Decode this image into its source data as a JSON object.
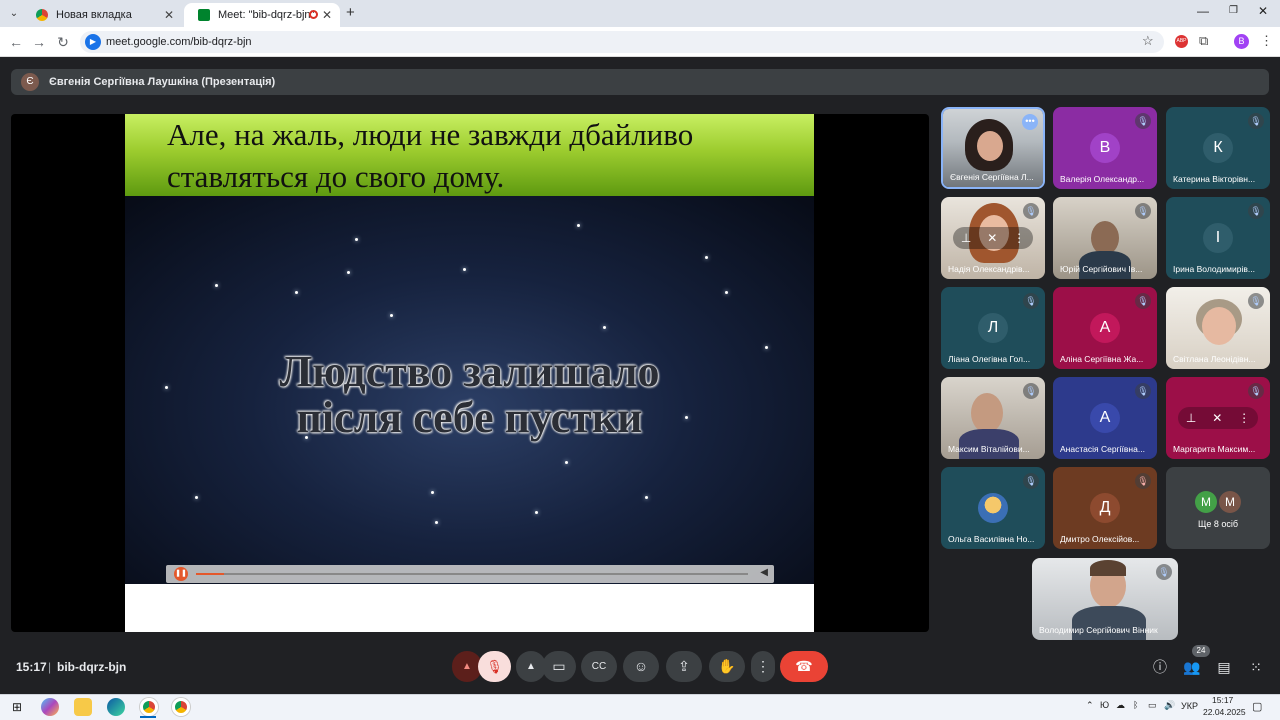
{
  "browser": {
    "tabs": [
      {
        "title": "Новая вкладка",
        "active": false
      },
      {
        "title": "Meet: \"bib-dqrz-bjn\"",
        "active": true
      }
    ],
    "new_tab": "+",
    "url": "meet.google.com/bib-dqrz-bjn",
    "profile_initial": "B"
  },
  "meet": {
    "presenter_bar": {
      "avatar": "Є",
      "title": "Євгенія Сергіївна Лаушкіна (Презентація)"
    },
    "slide": {
      "top_line1": "Але, на жаль, люди не завжди дбайливо",
      "top_line2": "ставляться до свого дому.",
      "main_line1": "Людство залишало",
      "main_line2": "після себе пустки"
    },
    "participants": [
      {
        "name": "Євгенія Сергіївна Л...",
        "type": "video"
      },
      {
        "name": "Валерія Олександр...",
        "initial": "В",
        "color": "#a142c7",
        "bg": "#8b2ca3"
      },
      {
        "name": "Катерина Вікторівн...",
        "initial": "К",
        "color": "#2f5d6b",
        "bg": "#1f4d5a"
      },
      {
        "name": "Надія Олександрів...",
        "type": "video"
      },
      {
        "name": "Юрій Сергійович Ів...",
        "type": "video"
      },
      {
        "name": "Ірина Володимирів...",
        "initial": "І",
        "color": "#2f5d6b",
        "bg": "#1f4d5a"
      },
      {
        "name": "Ліана Олегівна Гол...",
        "initial": "Л",
        "color": "#2f5d6b",
        "bg": "#1f4d5a"
      },
      {
        "name": "Аліна Сергіївна Жа...",
        "initial": "А",
        "color": "#c2185b",
        "bg": "#9c0f48"
      },
      {
        "name": "Світлана Леонідівн...",
        "type": "video"
      },
      {
        "name": "Максим Віталійови...",
        "type": "video"
      },
      {
        "name": "Анастасія Сергіївна...",
        "initial": "А",
        "color": "#3949ab",
        "bg": "#2d3a8c"
      },
      {
        "name": "Маргарита Максим...",
        "type": "hover",
        "bg": "#9c0f48"
      },
      {
        "name": "Ольга Василівна Но...",
        "type": "avatar-photo",
        "bg": "#1f4d5a"
      },
      {
        "name": "Дмитро Олексійов...",
        "initial": "Д",
        "color": "#8d4a2f",
        "bg": "#6d3b22"
      }
    ],
    "more": {
      "avatars": [
        "М",
        "М"
      ],
      "label": "Ще 8 осіб"
    },
    "self_tile": {
      "name": "Володимир Сергійович Вінник"
    },
    "time": "15:17",
    "meeting_code": "bib-dqrz-bjn",
    "people_count": "24",
    "colors": {
      "end_call": "#ea4335",
      "mic_off_bg": "#f9dedc",
      "accent": "#8ab4f8"
    }
  },
  "taskbar": {
    "lang": "УКР",
    "time": "15:17",
    "date": "22.04.2025"
  }
}
